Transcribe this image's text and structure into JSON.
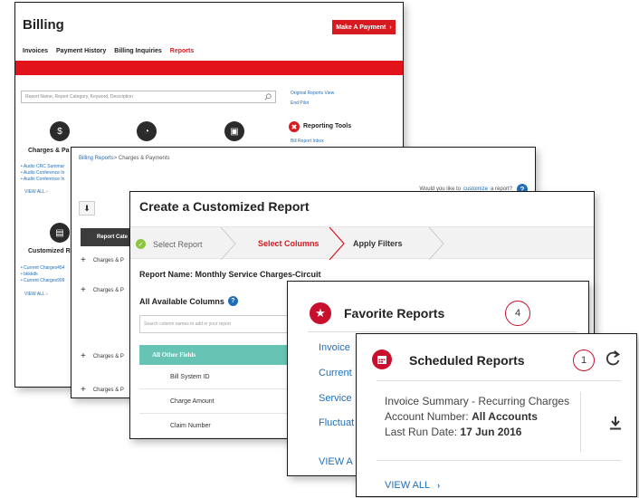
{
  "billing": {
    "title": "Billing",
    "make_payment": "Make A Payment",
    "nav": [
      "Invoices",
      "Payment History",
      "Billing Inquiries",
      "Reports"
    ],
    "active_nav": "Reports",
    "search_placeholder": "Report Name, Report Category, Keyword, Description",
    "side_links": [
      "Original Reports View",
      "End Pilot"
    ],
    "reporting_tools_title": "Reporting Tools",
    "reporting_tools_link": "Bill Report Inbox",
    "category1_title": "Charges & Pa",
    "category1_items": [
      "Audio CRC Summar",
      "Audio Conference In",
      "Audio Conference In"
    ],
    "category1_view_all": "VIEW ALL",
    "category2_title": "Customized R",
    "category2_items": [
      "Current Charges454",
      "bkkkdk",
      "Current Charges999"
    ],
    "category2_view_all": "VIEW ALL"
  },
  "billing_reports": {
    "breadcrumb_link": "Billing Reports",
    "breadcrumb_current": "> Charges & Payments",
    "customize_prefix": "Would you like to",
    "customize_link": "customize",
    "customize_suffix": "a report?",
    "table_header": "Report Cate",
    "rows": [
      "Charges & P",
      "Charges & P",
      "Charges & P",
      "Charges & P"
    ]
  },
  "create_report": {
    "title": "Create a Customized Report",
    "steps": [
      "Select Report",
      "Select Columns",
      "Apply Filters"
    ],
    "active_step": "Select Columns",
    "report_name": "Report Name: Monthly Service Charges-Circuit",
    "available_columns": "All Available Columns",
    "search_placeholder": "Search column names to add in your report",
    "group_label": "All Other Fields",
    "fields": [
      "Bill System ID",
      "Charge Amount",
      "Claim Number"
    ]
  },
  "favorite_reports": {
    "title": "Favorite Reports",
    "count": "4",
    "items": [
      "Invoice",
      "Current",
      "Service",
      "Fluctuat"
    ],
    "view_all": "VIEW A"
  },
  "scheduled_reports": {
    "title": "Scheduled Reports",
    "count": "1",
    "report_title": "Invoice Summary - Recurring Charges",
    "account_label": "Account Number:",
    "account_value": "All Accounts",
    "last_run_label": "Last Run Date:",
    "last_run_value": "17 Jun 2016",
    "view_all": "VIEW ALL"
  },
  "colors": {
    "brand_red": "#d71920",
    "link_blue": "#1f6eb7",
    "teal": "#67c3b3",
    "check_green": "#8cc63f"
  }
}
